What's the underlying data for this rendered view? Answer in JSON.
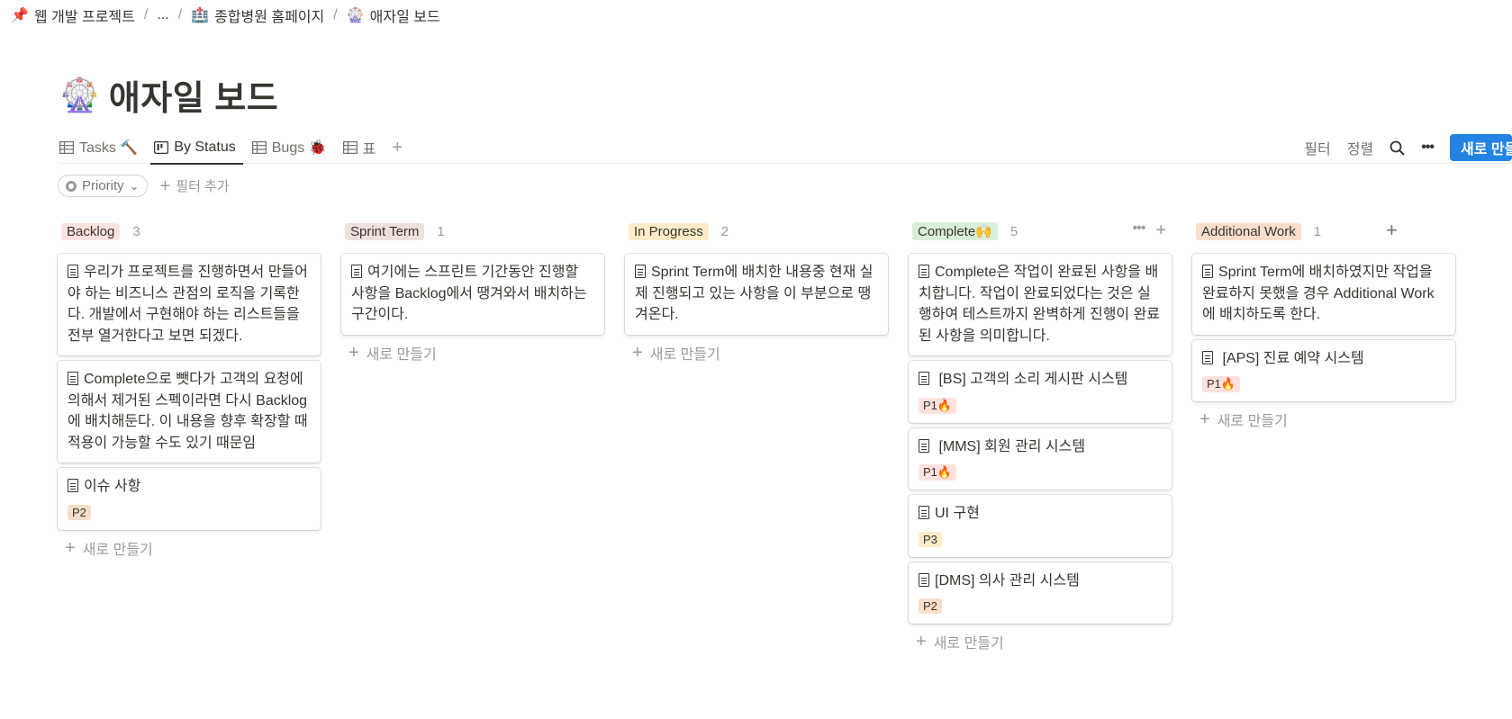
{
  "breadcrumb": {
    "items": [
      {
        "icon": "📌",
        "label": "웹 개발 프로젝트"
      },
      {
        "icon": "",
        "label": "..."
      },
      {
        "icon": "🏥",
        "label": "종합병원 홈페이지"
      },
      {
        "icon": "🎡",
        "label": "애자일 보드"
      }
    ],
    "separator": "/"
  },
  "page": {
    "icon": "🎡",
    "title": "애자일 보드"
  },
  "views": {
    "tabs": [
      {
        "label": "Tasks 🔨",
        "icon": "table-icon"
      },
      {
        "label": "By Status",
        "icon": "board-icon"
      },
      {
        "label": "Bugs 🐞",
        "icon": "table-icon"
      },
      {
        "label": "표",
        "icon": "table-icon"
      }
    ],
    "add_view": "+"
  },
  "toolbar": {
    "filter": "필터",
    "sort": "정렬",
    "search_icon": "🔍",
    "more": "•••",
    "new": "새로 만들기"
  },
  "filters": {
    "chip_label": "Priority",
    "chip_chevron": "⌄",
    "add_filter": "필터 추가"
  },
  "board": {
    "new_item_label": "새로 만들기",
    "plus": "+",
    "col_more": "•••",
    "columns": [
      {
        "name": "Backlog",
        "count": "3",
        "color": "#ffe2dd",
        "cards": [
          {
            "title": "우리가 프로젝트를 진행하면서 만들어야 하는 비즈니스 관점의 로직을 기록한다. 개발에서 구현해야 하는 리스트들을 전부 열거한다고 보면 되겠다.",
            "tag": ""
          },
          {
            "title": "Complete으로 뺏다가 고객의 요청에 의해서 제거된 스펙이라면 다시 Backlog에 배치해둔다. 이 내용을 향후 확장할 때 적용이 가능할 수도 있기 때문임",
            "tag": ""
          },
          {
            "title": "이슈 사항",
            "tag": "P2"
          }
        ]
      },
      {
        "name": "Sprint Term",
        "count": "1",
        "color": "#eee0da",
        "cards": [
          {
            "title": "여기에는 스프린트 기간동안 진행할 사항을 Backlog에서 땡겨와서 배치하는 구간이다.",
            "tag": ""
          }
        ]
      },
      {
        "name": "In Progress",
        "count": "2",
        "color": "#fdecc8",
        "cards": [
          {
            "title": "Sprint Term에 배치한 내용중 현재 실제 진행되고 있는 사항을 이 부분으로 땡겨온다.",
            "tag": ""
          }
        ]
      },
      {
        "name": "Complete🙌",
        "count": "5",
        "color": "#dbeddb",
        "cards": [
          {
            "title": "Complete은 작업이 완료된 사항을 배치합니다. 작업이 완료되었다는 것은 실행하여 테스트까지 완벽하게 진행이 완료된 사항을 의미합니다.",
            "tag": ""
          },
          {
            "title": " [BS] 고객의 소리 게시판 시스템",
            "tag": "P1🔥"
          },
          {
            "title": " [MMS] 회원 관리 시스템",
            "tag": "P1🔥"
          },
          {
            "title": "UI 구현",
            "tag": "P3"
          },
          {
            "title": "[DMS] 의사 관리 시스템",
            "tag": "P2"
          }
        ]
      },
      {
        "name": "Additional Work",
        "count": "1",
        "color": "#fadec9",
        "cards": [
          {
            "title": "Sprint Term에 배치하였지만 작업을 완료하지 못했을 경우 Additional Work에 배치하도록 한다.",
            "tag": ""
          },
          {
            "title": " [APS] 진료 예약 시스템",
            "tag": "P1🔥"
          }
        ]
      }
    ]
  },
  "tag_colors": {
    "P1🔥": "#ffe2dd",
    "P2": "#fadec9",
    "P3": "#fdecc8"
  },
  "accent": "#2383e2"
}
